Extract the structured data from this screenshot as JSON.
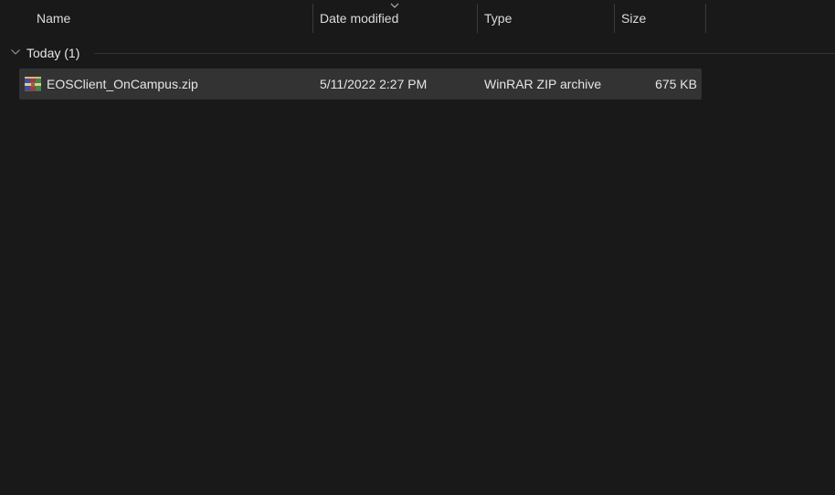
{
  "columns": {
    "name": "Name",
    "date": "Date modified",
    "type": "Type",
    "size": "Size"
  },
  "sort": {
    "column": "date",
    "direction": "descending"
  },
  "group": {
    "label": "Today (1)",
    "expanded": true
  },
  "files": [
    {
      "name": "EOSClient_OnCampus.zip",
      "date": "5/11/2022 2:27 PM",
      "type": "WinRAR ZIP archive",
      "size": "675 KB",
      "icon": "winrar-archive-icon",
      "selected": true
    }
  ],
  "colors": {
    "background": "#191919",
    "selected_row": "#333333",
    "text": "#e6e6e6"
  }
}
